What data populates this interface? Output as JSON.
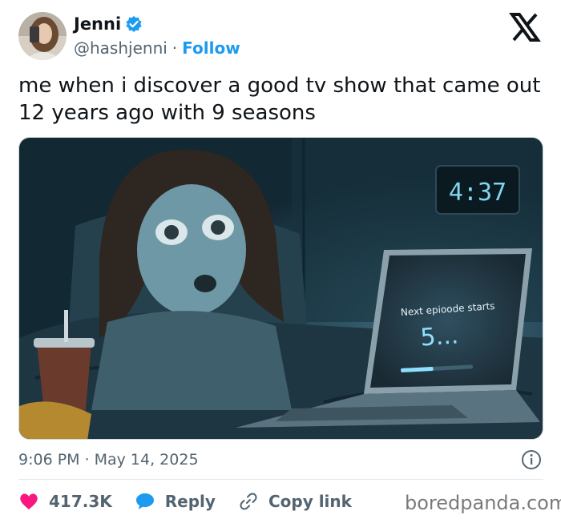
{
  "author": {
    "name": "Jenni",
    "handle": "@hashjenni",
    "separator": "·",
    "follow_label": "Follow"
  },
  "tweet": {
    "text": "me when i discover a good tv show that came out 12 years ago with 9 seasons"
  },
  "media": {
    "clock_time": "4:37",
    "screen_text": "Next epioode starts",
    "countdown": "5...",
    "progress_fraction": 0.45
  },
  "meta": {
    "time": "9:06 PM",
    "separator": "·",
    "date": "May 14, 2025"
  },
  "actions": {
    "likes": "417.3K",
    "reply_label": "Reply",
    "copy_label": "Copy link"
  },
  "watermark": "boredpanda.com",
  "colors": {
    "accent": "#1d9bf0",
    "like": "#f91880",
    "muted": "#536471"
  },
  "icons": [
    "verified-badge-icon",
    "x-logo-icon",
    "info-icon",
    "heart-icon",
    "reply-bubble-icon",
    "link-icon"
  ]
}
